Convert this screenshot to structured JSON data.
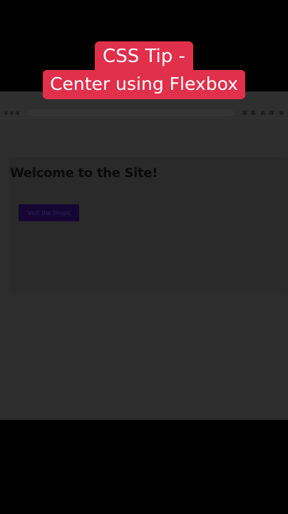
{
  "caption": {
    "line1": "CSS Tip -",
    "line2": "Center using Flexbox"
  },
  "page": {
    "heading": "Welcome to the Site!",
    "button_label": "Visit the Shops"
  },
  "colors": {
    "caption_bg": "#e0304b",
    "caption_text": "#ffffff",
    "button_bg": "#150732",
    "overlay": "#2d2d2d"
  }
}
